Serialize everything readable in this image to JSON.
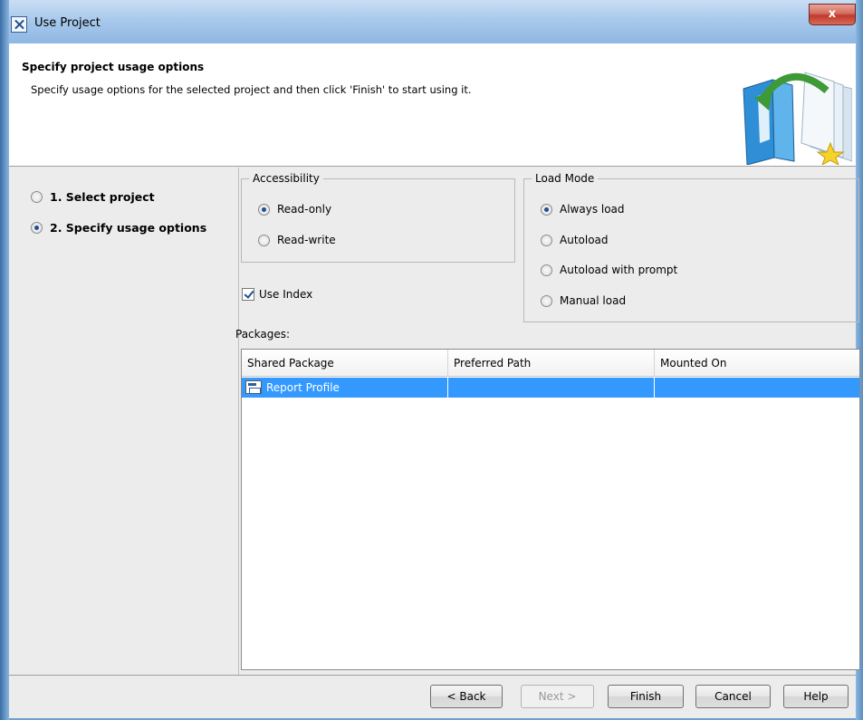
{
  "window": {
    "title": "Use Project",
    "close_glyph": "x"
  },
  "header": {
    "title": "Specify project usage options",
    "description": "Specify usage options for the selected project and then click 'Finish' to start using it.",
    "graphic": "wizard-project-icon"
  },
  "steps": [
    {
      "label": "1. Select project",
      "selected": false
    },
    {
      "label": "2. Specify usage options",
      "selected": true
    }
  ],
  "accessibility": {
    "legend": "Accessibility",
    "options": [
      {
        "label": "Read-only",
        "selected": true
      },
      {
        "label": "Read-write",
        "selected": false
      }
    ]
  },
  "load_mode": {
    "legend": "Load Mode",
    "options": [
      {
        "label": "Always load",
        "selected": true
      },
      {
        "label": "Autoload",
        "selected": false
      },
      {
        "label": "Autoload with prompt",
        "selected": false
      },
      {
        "label": "Manual load",
        "selected": false
      }
    ]
  },
  "use_index": {
    "label": "Use Index",
    "checked": true
  },
  "packages": {
    "label": "Packages:",
    "columns": [
      "Shared Package",
      "Preferred Path",
      "Mounted On"
    ],
    "rows": [
      {
        "shared_package": "Report Profile",
        "preferred_path": "",
        "mounted_on": "",
        "icon": "package-icon",
        "selected": true
      }
    ],
    "selection_color": "#3399ff"
  },
  "buttons": {
    "back": "< Back",
    "next": "Next >",
    "finish": "Finish",
    "cancel": "Cancel",
    "help": "Help"
  }
}
